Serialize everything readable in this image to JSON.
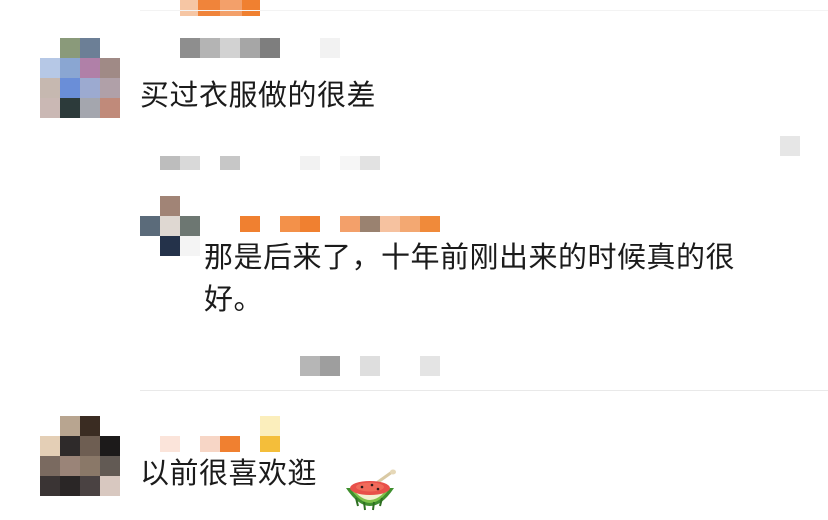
{
  "comments": [
    {
      "text": "买过衣服做的很差",
      "reply": {
        "text": "那是后来了，十年前刚出来的时候真的很好。"
      }
    },
    {
      "text": "以前很喜欢逛",
      "emoji": "watermelon-icon"
    }
  ],
  "colors": {
    "background": "#ffffff",
    "text": "#1b1b1b",
    "accent_username": "#f08030",
    "divider": "#e9e9e9"
  }
}
